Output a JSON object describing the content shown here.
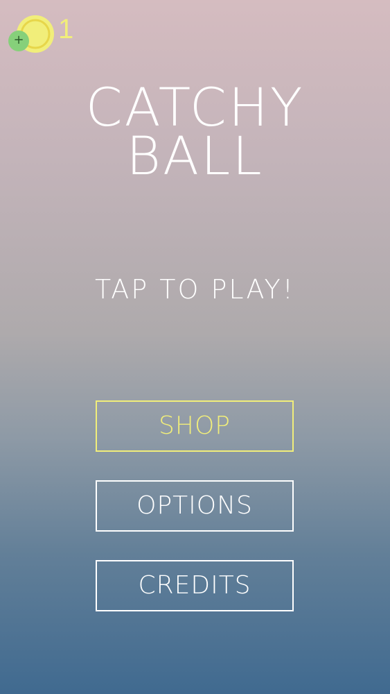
{
  "hud": {
    "coin_icon": "coin-icon",
    "add_icon": "plus-icon",
    "add_symbol": "+",
    "coin_count": "1"
  },
  "title": {
    "line1": "CATCHY",
    "line2": "BALL"
  },
  "prompt": "TAP TO PLAY!",
  "menu": {
    "shop": "SHOP",
    "options": "OPTIONS",
    "credits": "CREDITS"
  },
  "colors": {
    "accent": "#f1ee7a",
    "plus_badge": "#86d07a",
    "text": "#ffffff",
    "gradient_top": "#d5bcc0",
    "gradient_bottom": "#406a90"
  }
}
